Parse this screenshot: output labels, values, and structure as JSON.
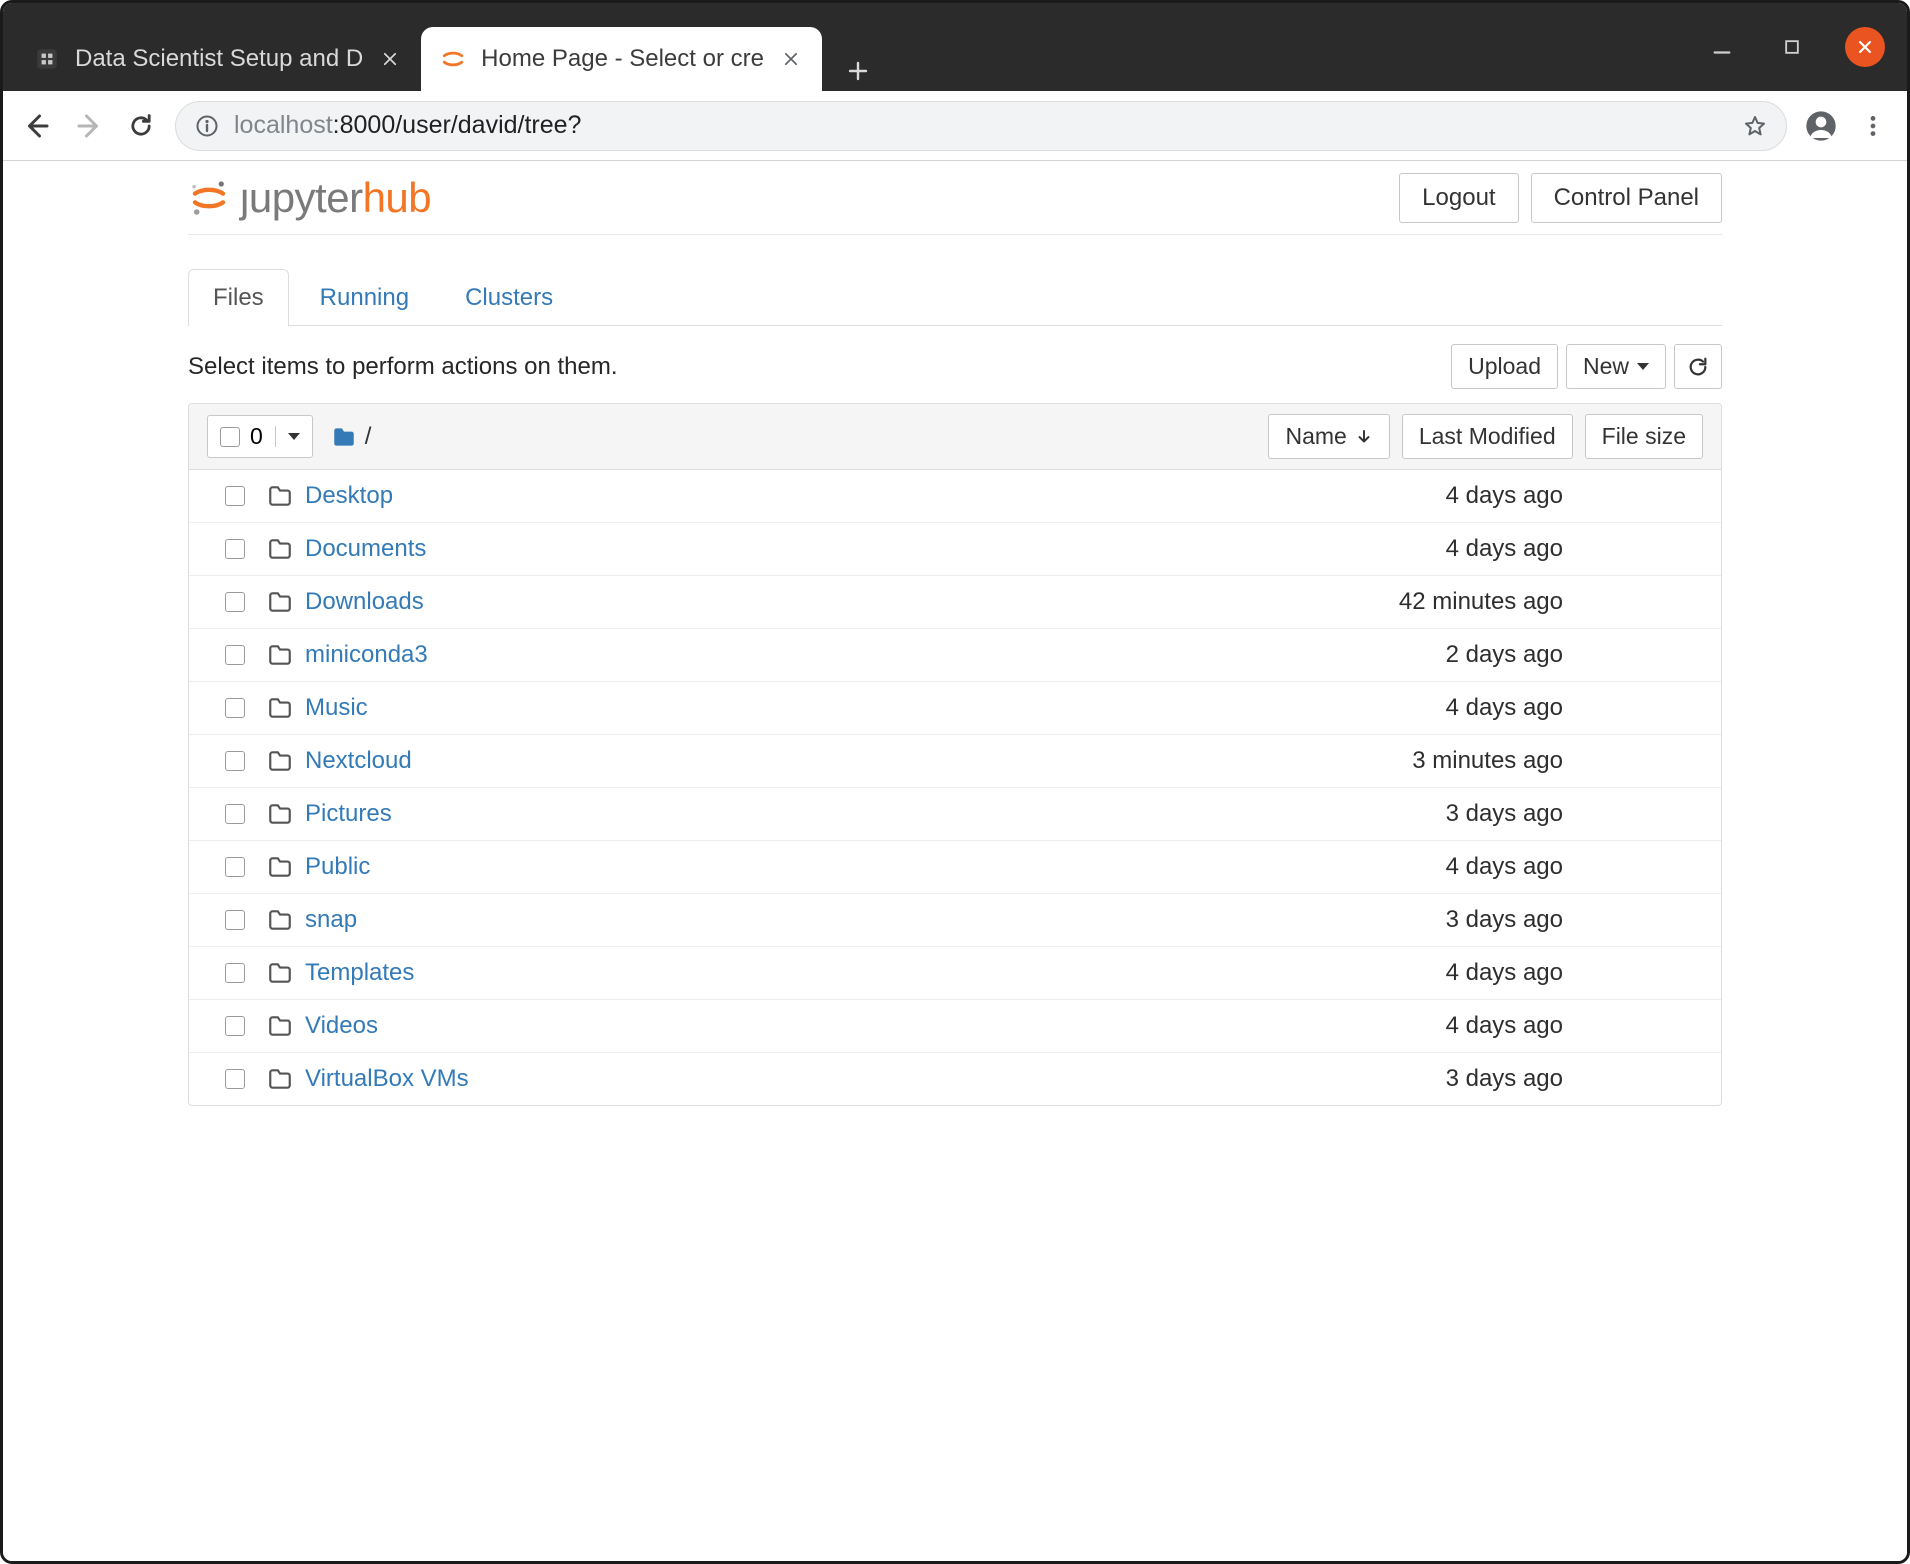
{
  "browser": {
    "tabs": [
      {
        "title": "Data Scientist Setup and D",
        "active": false
      },
      {
        "title": "Home Page - Select or cre",
        "active": true
      }
    ],
    "url_host_dim": "localhost",
    "url_port_path": ":8000/user/david/tree?"
  },
  "header": {
    "logo_text_1": "ȷupyter",
    "logo_text_2": "hub",
    "logout": "Logout",
    "control_panel": "Control Panel"
  },
  "tabs": {
    "files": "Files",
    "running": "Running",
    "clusters": "Clusters"
  },
  "actions": {
    "blurb": "Select items to perform actions on them.",
    "upload": "Upload",
    "new": "New"
  },
  "listhead": {
    "selected_count": "0",
    "breadcrumb_sep": "/",
    "name": "Name",
    "last_modified": "Last Modified",
    "file_size": "File size"
  },
  "rows": [
    {
      "name": "Desktop",
      "modified": "4 days ago",
      "size": ""
    },
    {
      "name": "Documents",
      "modified": "4 days ago",
      "size": ""
    },
    {
      "name": "Downloads",
      "modified": "42 minutes ago",
      "size": ""
    },
    {
      "name": "miniconda3",
      "modified": "2 days ago",
      "size": ""
    },
    {
      "name": "Music",
      "modified": "4 days ago",
      "size": ""
    },
    {
      "name": "Nextcloud",
      "modified": "3 minutes ago",
      "size": ""
    },
    {
      "name": "Pictures",
      "modified": "3 days ago",
      "size": ""
    },
    {
      "name": "Public",
      "modified": "4 days ago",
      "size": ""
    },
    {
      "name": "snap",
      "modified": "3 days ago",
      "size": ""
    },
    {
      "name": "Templates",
      "modified": "4 days ago",
      "size": ""
    },
    {
      "name": "Videos",
      "modified": "4 days ago",
      "size": ""
    },
    {
      "name": "VirtualBox VMs",
      "modified": "3 days ago",
      "size": ""
    }
  ]
}
